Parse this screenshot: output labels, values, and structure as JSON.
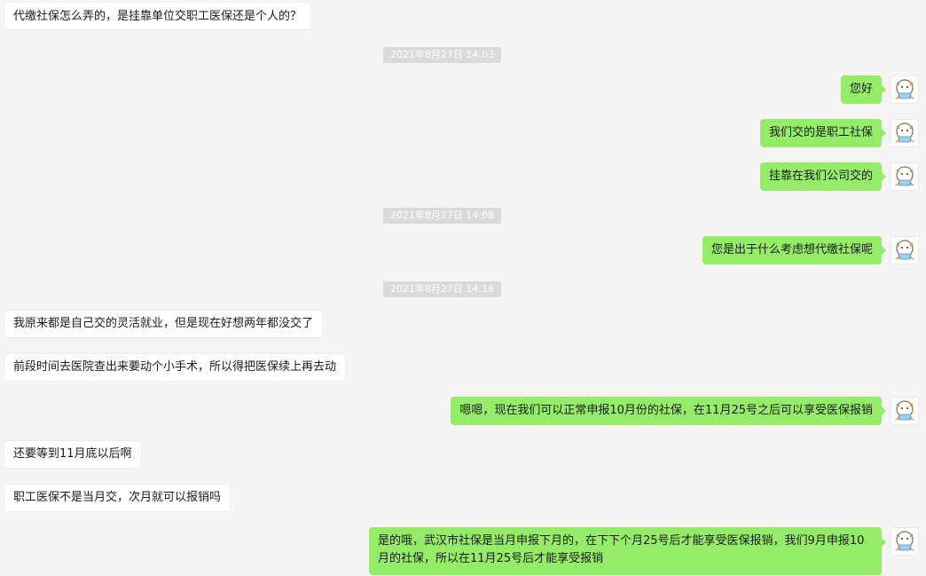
{
  "chat": {
    "messages": [
      {
        "id": "m1",
        "side": "in",
        "text": "代缴社保怎么弄的，是挂靠单位交职工医保还是个人的？"
      },
      {
        "id": "t1",
        "type": "time",
        "text": "2021年8月27日 14:03"
      },
      {
        "id": "m2",
        "side": "out",
        "text": "您好"
      },
      {
        "id": "m3",
        "side": "out",
        "text": "我们交的是职工社保"
      },
      {
        "id": "m4",
        "side": "out",
        "text": "挂靠在我们公司交的"
      },
      {
        "id": "t2",
        "type": "time",
        "text": "2021年8月27日 14:08"
      },
      {
        "id": "m5",
        "side": "out",
        "text": "您是出于什么考虑想代缴社保呢"
      },
      {
        "id": "t3",
        "type": "time",
        "text": "2021年8月27日 14:16"
      },
      {
        "id": "m6",
        "side": "in",
        "text": "我原来都是自己交的灵活就业，但是现在好想两年都没交了"
      },
      {
        "id": "m7",
        "side": "in",
        "text": "前段时间去医院查出来要动个小手术，所以得把医保续上再去动"
      },
      {
        "id": "m8",
        "side": "out",
        "text": "嗯嗯，现在我们可以正常申报10月份的社保，在11月25号之后可以享受医保报销"
      },
      {
        "id": "m9",
        "side": "in",
        "text": "还要等到11月底以后啊"
      },
      {
        "id": "m10",
        "side": "in",
        "text": "职工医保不是当月交，次月就可以报销吗"
      },
      {
        "id": "m11",
        "side": "out",
        "text": "是的哦，武汉市社保是当月申报下月的，在下下个月25号后才能享受医保报销，我们9月申报10月的社保，所以在11月25号后才能享受报销"
      }
    ]
  },
  "colors": {
    "background": "#f5f5f5",
    "outgoing_bubble": "#95ec69",
    "incoming_bubble": "#ffffff",
    "timestamp_bg": "#dadada"
  },
  "icons": {
    "avatar": "cartoon-avatar-icon"
  }
}
